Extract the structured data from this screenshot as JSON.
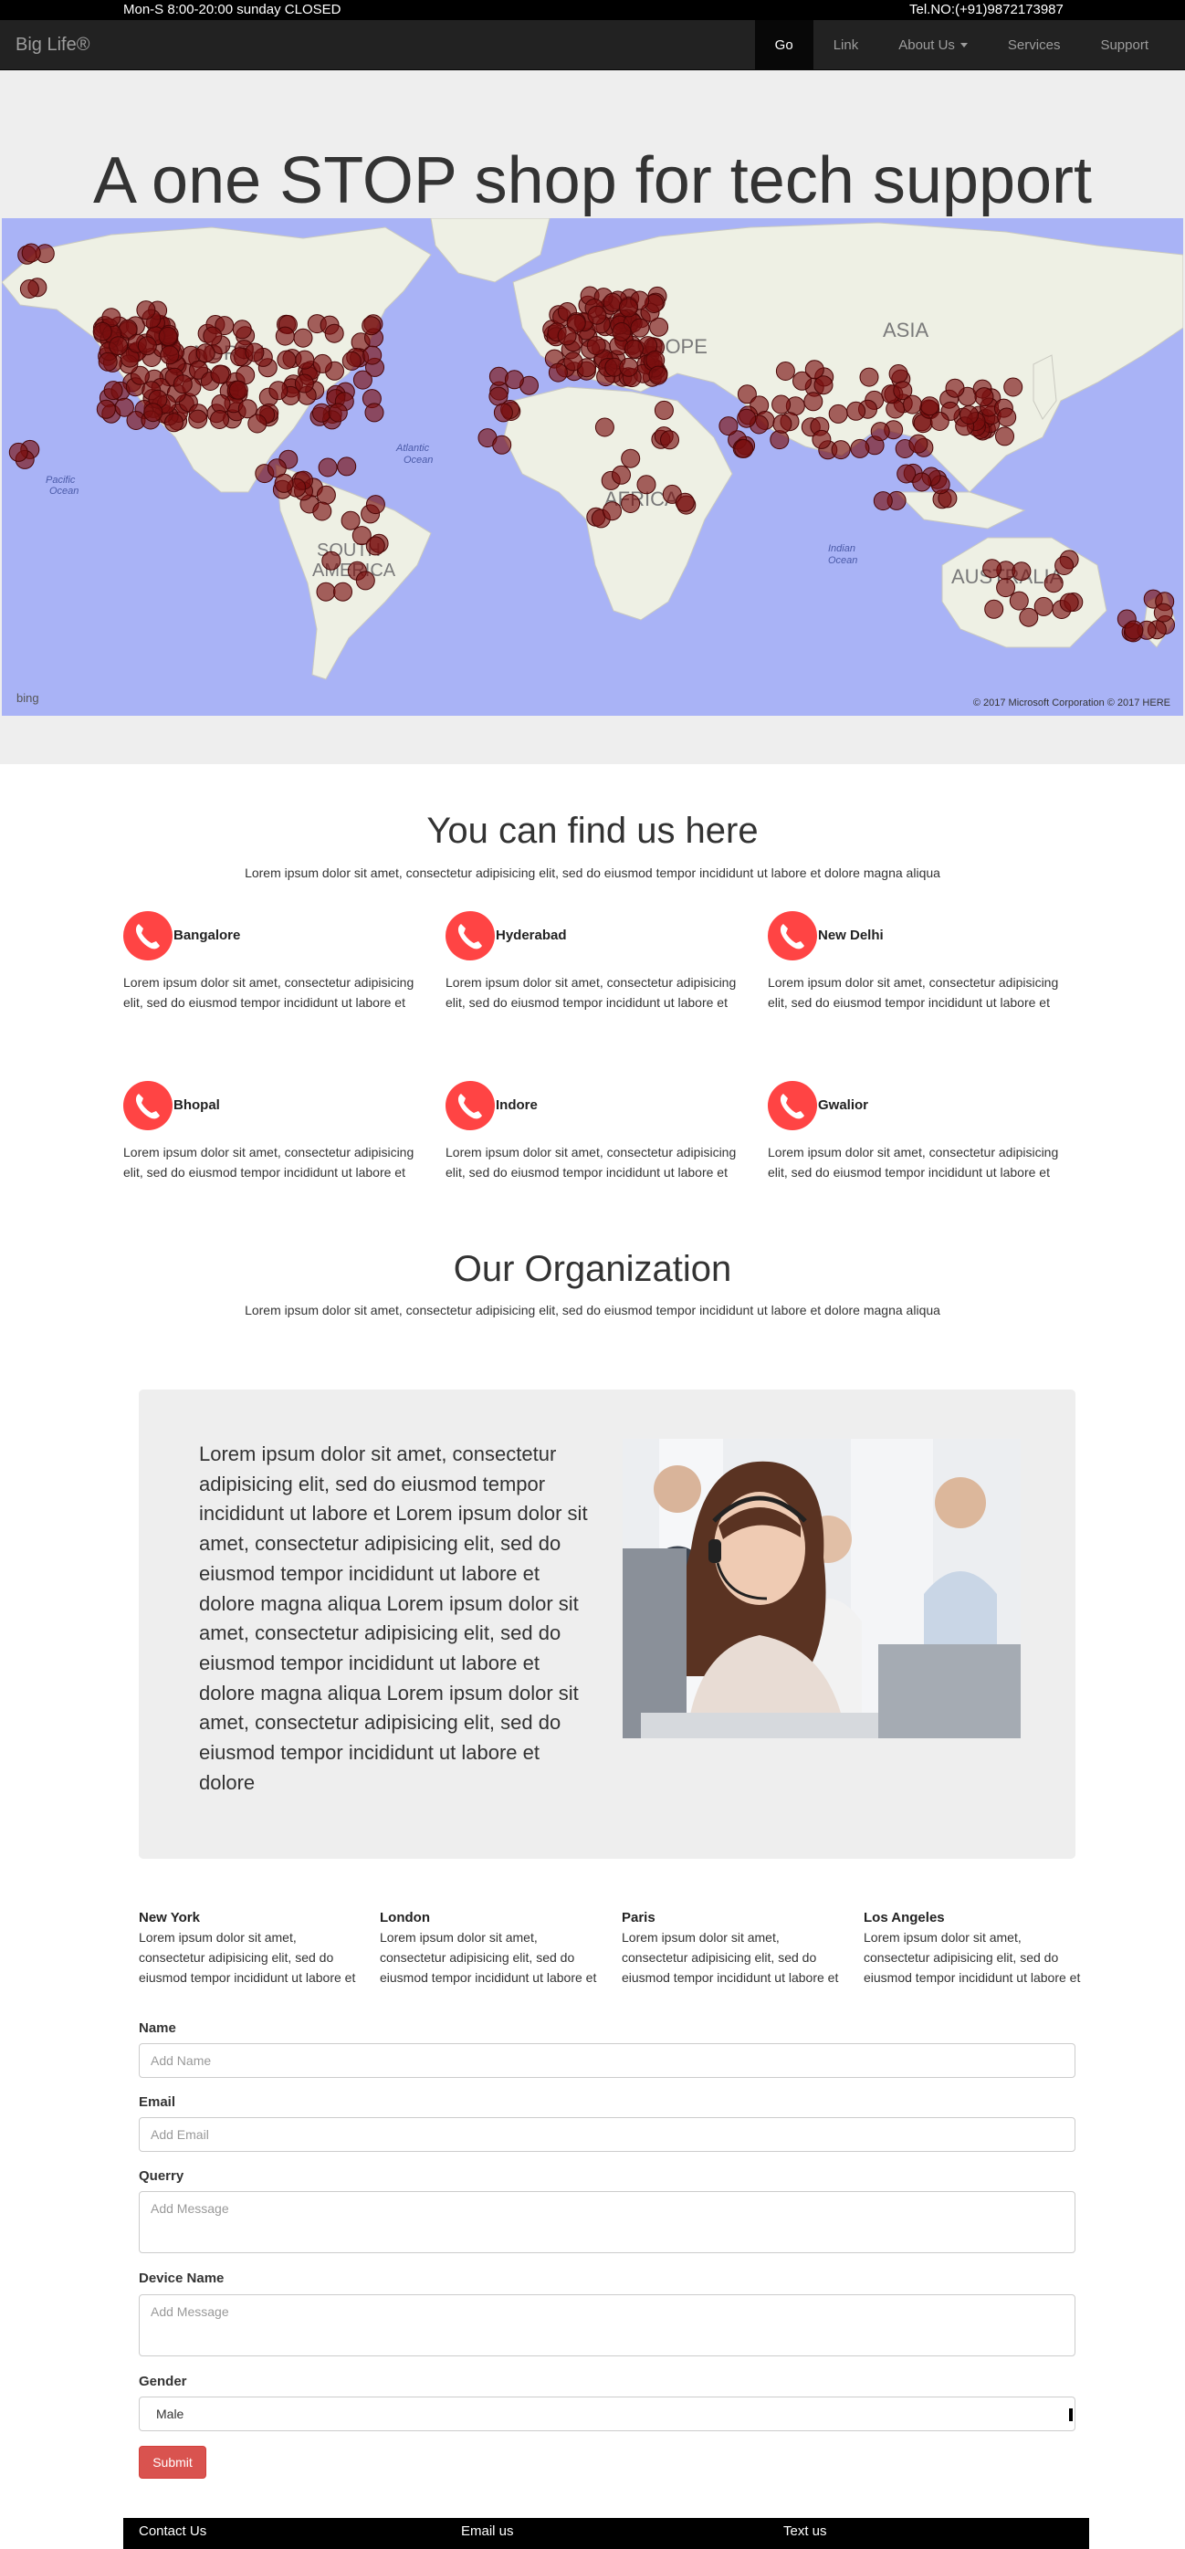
{
  "topbar": {
    "hours": "Mon-S 8:00-20:00 sunday CLOSED",
    "phone": "Tel.NO:(+91)9872173987"
  },
  "navbar": {
    "brand": "Big Life®",
    "items": [
      {
        "label": "Go",
        "active": true
      },
      {
        "label": "Link"
      },
      {
        "label": "About Us",
        "dropdown": true
      },
      {
        "label": "Services"
      },
      {
        "label": "Support"
      }
    ]
  },
  "hero": {
    "title": "A one STOP shop for tech support",
    "map": {
      "labels": [
        "NORTH",
        "EUROPE",
        "ASIA",
        "AFRICA",
        "SOUTH AMERICA",
        "AUSTRALIA",
        "Atlantic Ocean",
        "Pacific Ocean",
        "Indian Ocean"
      ],
      "provider": "bing",
      "copyright": "© 2017 Microsoft Corporation    © 2017 HERE"
    }
  },
  "find_us": {
    "title": "You can find us here",
    "subtitle": "Lorem ipsum dolor sit amet, consectetur adipisicing elit, sed do eiusmod tempor incididunt ut labore et dolore magna aliqua",
    "locations": [
      {
        "city": "Bangalore",
        "text": "Lorem ipsum dolor sit amet, consectetur adipisicing elit, sed do eiusmod tempor incididunt ut labore et"
      },
      {
        "city": "Hyderabad",
        "text": "Lorem ipsum dolor sit amet, consectetur adipisicing elit, sed do eiusmod tempor incididunt ut labore et"
      },
      {
        "city": "New Delhi",
        "text": "Lorem ipsum dolor sit amet, consectetur adipisicing elit, sed do eiusmod tempor incididunt ut labore et"
      },
      {
        "city": "Bhopal",
        "text": "Lorem ipsum dolor sit amet, consectetur adipisicing elit, sed do eiusmod tempor incididunt ut labore et"
      },
      {
        "city": "Indore",
        "text": "Lorem ipsum dolor sit amet, consectetur adipisicing elit, sed do eiusmod tempor incididunt ut labore et"
      },
      {
        "city": "Gwalior",
        "text": "Lorem ipsum dolor sit amet, consectetur adipisicing elit, sed do eiusmod tempor incididunt ut labore et"
      }
    ]
  },
  "organization": {
    "title": "Our Organization",
    "subtitle": "Lorem ipsum dolor sit amet, consectetur adipisicing elit, sed do eiusmod tempor incididunt ut labore et dolore magna aliqua",
    "body": "Lorem ipsum dolor sit amet, consectetur adipisicing elit, sed do eiusmod tempor incididunt ut labore et Lorem ipsum dolor sit amet, consectetur adipisicing elit, sed do eiusmod tempor incididunt ut labore et dolore magna aliqua Lorem ipsum dolor sit amet, consectetur adipisicing elit, sed do eiusmod tempor incididunt ut labore et dolore magna aliqua Lorem ipsum dolor sit amet, consectetur adipisicing elit, sed do eiusmod tempor incididunt ut labore et dolore"
  },
  "cities": [
    {
      "name": "New York",
      "text": "Lorem ipsum dolor sit amet, consectetur adipisicing elit, sed do eiusmod tempor incididunt ut labore et"
    },
    {
      "name": "London",
      "text": "Lorem ipsum dolor sit amet, consectetur adipisicing elit, sed do eiusmod tempor incididunt ut labore et"
    },
    {
      "name": "Paris",
      "text": "Lorem ipsum dolor sit amet, consectetur adipisicing elit, sed do eiusmod tempor incididunt ut labore et"
    },
    {
      "name": "Los Angeles",
      "text": "Lorem ipsum dolor sit amet, consectetur adipisicing elit, sed do eiusmod tempor incididunt ut labore et"
    }
  ],
  "form": {
    "name": {
      "label": "Name",
      "placeholder": "Add Name"
    },
    "email": {
      "label": "Email",
      "placeholder": "Add Email"
    },
    "query": {
      "label": "Querry",
      "placeholder": "Add Message"
    },
    "device": {
      "label": "Device Name",
      "placeholder": "Add Message"
    },
    "gender": {
      "label": "Gender",
      "value": "Male"
    },
    "submit": "Submit"
  },
  "footer": {
    "contact": "Contact Us",
    "email": "Email us",
    "text": "Text us"
  },
  "colors": {
    "accent": "#d9534f",
    "icon": "#ff4444",
    "navbar": "#222222",
    "map_water": "#a9b3f6",
    "marker": "#7a1010"
  }
}
